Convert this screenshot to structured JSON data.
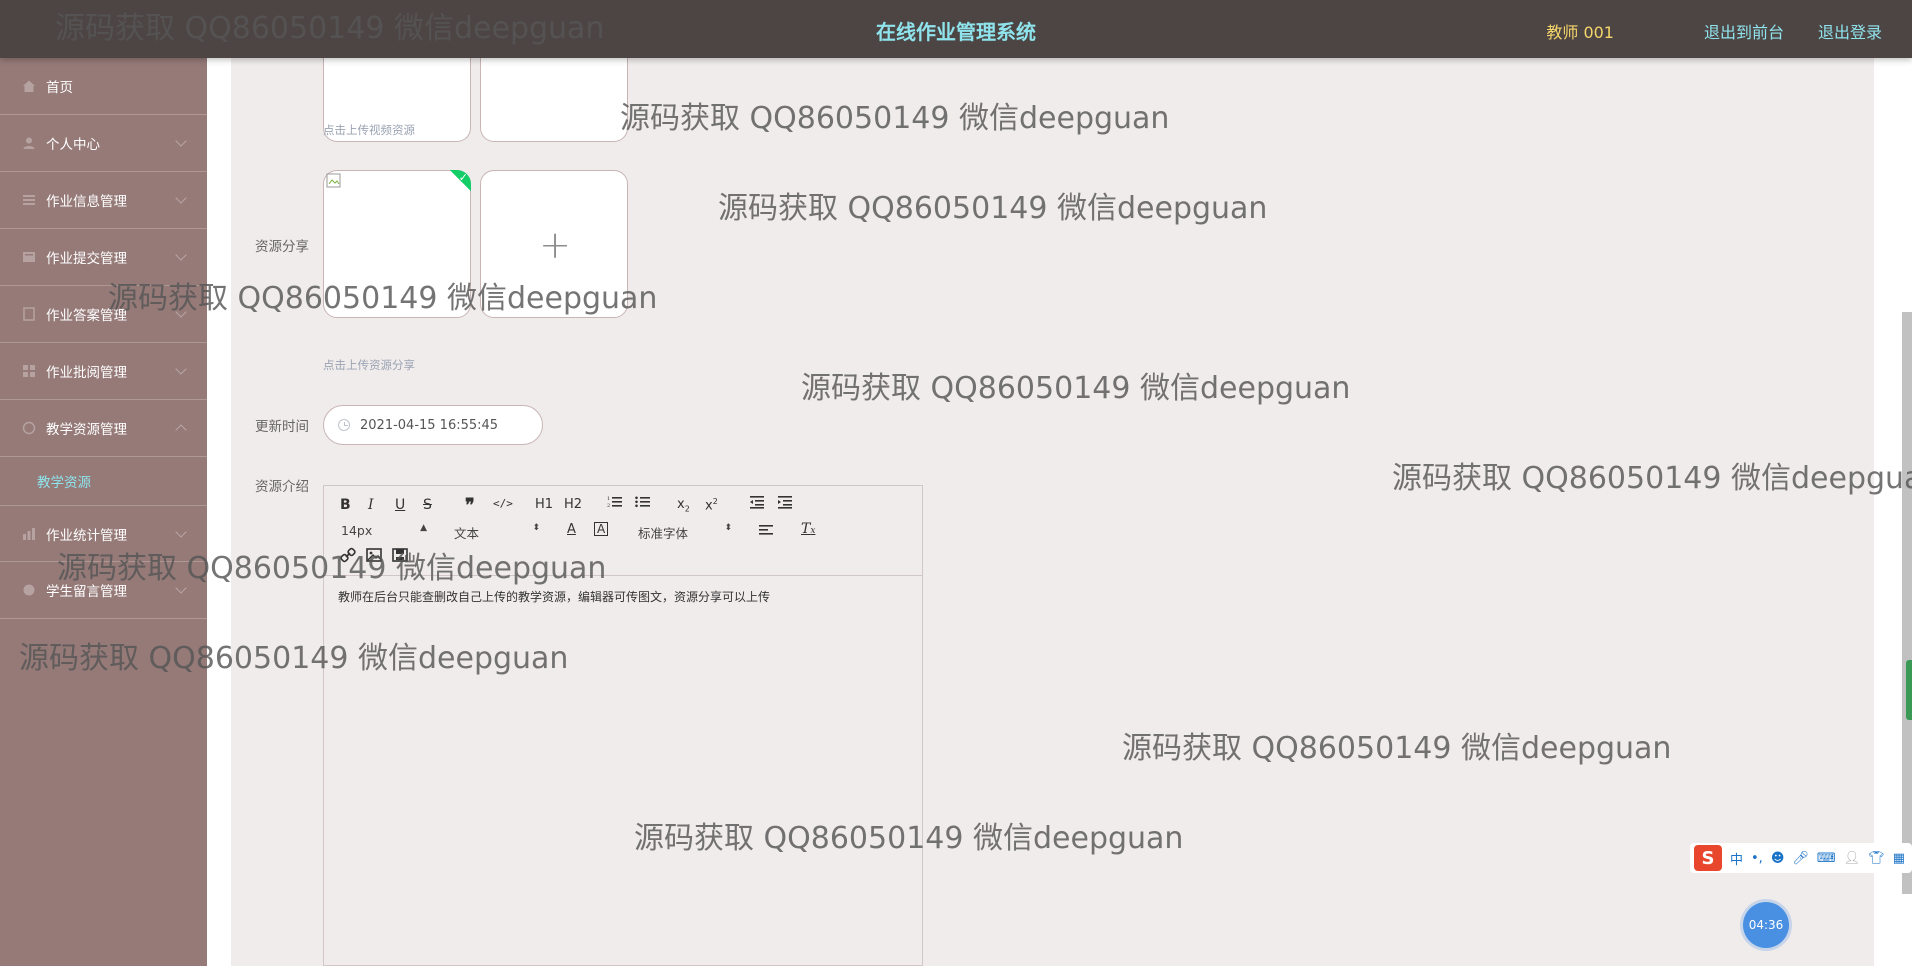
{
  "header": {
    "title": "在线作业管理系统",
    "user": "教师 001",
    "back_to_front": "退出到前台",
    "logout": "退出登录"
  },
  "sidebar": {
    "items": [
      {
        "label": "首页",
        "icon": "home-icon"
      },
      {
        "label": "个人中心",
        "icon": "user-icon"
      },
      {
        "label": "作业信息管理",
        "icon": "list-icon"
      },
      {
        "label": "作业提交管理",
        "icon": "folder-icon"
      },
      {
        "label": "作业答案管理",
        "icon": "document-icon"
      },
      {
        "label": "作业批阅管理",
        "icon": "grid-icon"
      },
      {
        "label": "教学资源管理",
        "icon": "cloud-icon"
      }
    ],
    "active_sub": "教学资源",
    "items_after": [
      {
        "label": "作业统计管理",
        "icon": "chart-icon"
      },
      {
        "label": "学生留言管理",
        "icon": "message-icon"
      }
    ]
  },
  "form": {
    "video_hint": "点击上传视频资源",
    "share_label": "资源分享",
    "share_hint": "点击上传资源分享",
    "update_time_label": "更新时间",
    "update_time_value": "2021-04-15 16:55:45",
    "intro_label": "资源介绍"
  },
  "editor": {
    "toolbar": {
      "font_size": "14px",
      "block_type": "文本",
      "font_family": "标准字体",
      "h1": "H1",
      "h2": "H2"
    },
    "content": "教师在后台只能查删改自己上传的教学资源，编辑器可传图文，资源分享可以上传"
  },
  "watermark_text": "源码获取 QQ86050149 微信deepguan",
  "watermark_text_cut": "源码获取 QQ86050149 微信deepgua",
  "ime": {
    "lang": "中"
  },
  "timer": "04:36"
}
